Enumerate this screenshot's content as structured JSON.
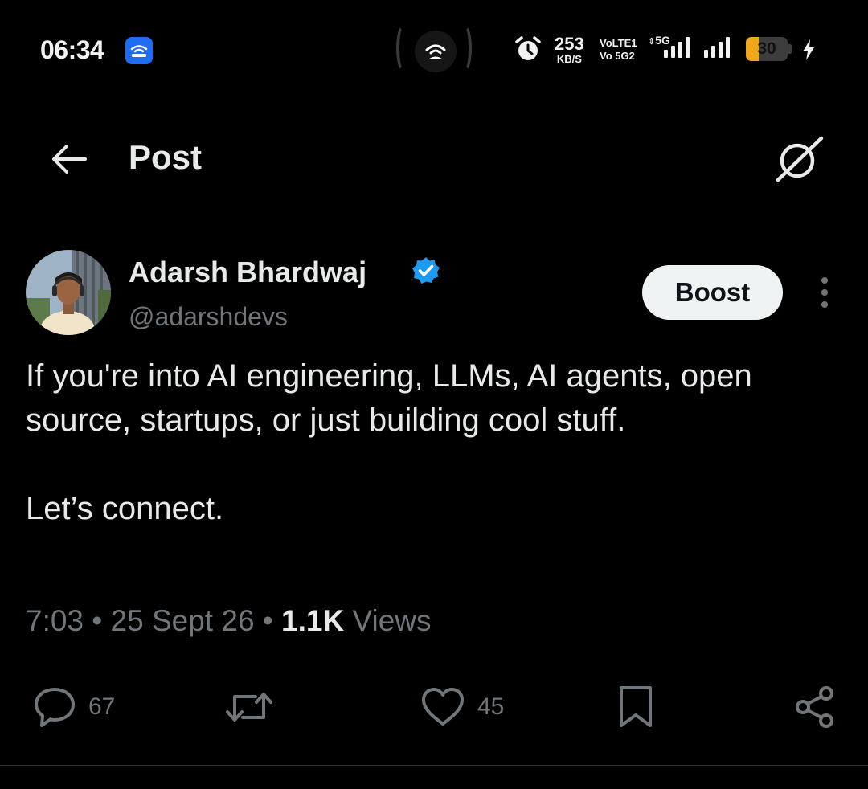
{
  "status_bar": {
    "time": "06:34",
    "net_speed_value": "253",
    "net_speed_unit": "KB/S",
    "volte_top": "VoLTE1",
    "volte_bottom": "Vo 5G2",
    "network_label": "5G",
    "battery_percent": "30",
    "battery_level": 0.3,
    "battery_color": "#f0a818",
    "icons": [
      "app-notification-icon",
      "hotspot-icon",
      "alarm-icon",
      "signal-icon",
      "battery-icon",
      "charging-icon"
    ]
  },
  "header": {
    "title": "Post",
    "back_icon": "arrow-left-icon",
    "grok_icon": "grok-icon"
  },
  "post": {
    "author": {
      "display_name": "Adarsh Bhardwaj",
      "handle": "@adarshdevs",
      "verified": true,
      "verified_color": "#1d9bf0"
    },
    "boost_label": "Boost",
    "paragraphs": [
      "If you're into AI engineering, LLMs, AI agents, open source, startups, or just building cool stuff.",
      "Let’s connect."
    ],
    "meta": {
      "time": "7:03",
      "sep1": " • ",
      "date": "25 Sept 26",
      "sep2": " • ",
      "views_count": "1.1K",
      "views_label": " Views"
    },
    "actions": {
      "replies": "67",
      "likes": "45"
    }
  },
  "colors": {
    "background": "#000000",
    "text_primary": "#e7e9ea",
    "text_secondary": "#71767b",
    "boost_bg": "#eff3f4"
  }
}
